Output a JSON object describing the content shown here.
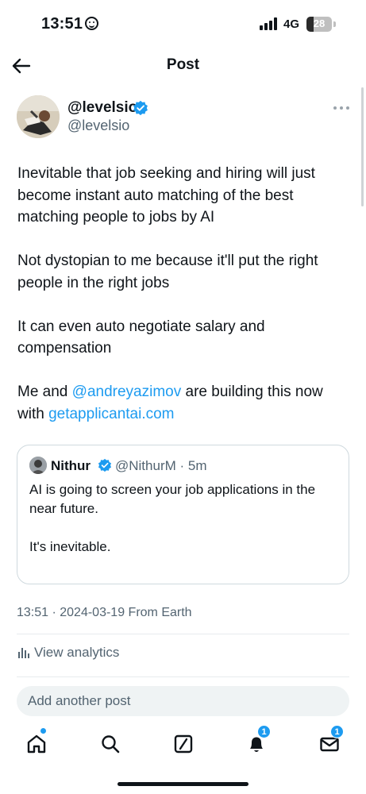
{
  "status_bar": {
    "time": "13:51",
    "network": "4G",
    "battery": "28",
    "battery_level": 0.28
  },
  "header": {
    "title": "Post",
    "back_icon": "arrow-left-icon"
  },
  "post": {
    "author": {
      "display_name": "@levelsio",
      "handle": "@levelsio",
      "verified": true
    },
    "paragraph_1": "Inevitable that job seeking and hiring will just become instant auto matching of the best matching people to jobs by AI",
    "paragraph_2": "Not dystopian to me because it'll put the right people in the right jobs",
    "paragraph_3": "It can even auto negotiate salary and compensation",
    "paragraph_4": {
      "text_before": "Me and ",
      "mention": "@andreyazimov",
      "text_middle": " are building this now with ",
      "link": "getapplicantai.com"
    },
    "timestamp": "13:51 · 2024-03-19 From Earth"
  },
  "quote": {
    "name": "Nithur",
    "handle_time": "@NithurM · 5m",
    "paragraph_1": "AI is going to screen your job applications in the near future.",
    "paragraph_2": "It's inevitable."
  },
  "analytics_label": "View analytics",
  "reply_placeholder": "Add another post",
  "tabs": [
    {
      "name": "home",
      "icon": "home-icon",
      "has_dot": true
    },
    {
      "name": "search",
      "icon": "search-icon"
    },
    {
      "name": "grok",
      "icon": "grok-icon"
    },
    {
      "name": "notifications",
      "icon": "bell-icon",
      "badge": "1"
    },
    {
      "name": "messages",
      "icon": "mail-icon",
      "badge": "1"
    }
  ],
  "colors": {
    "accent": "#1d9bf0",
    "text": "#0f1419",
    "muted": "#536471"
  }
}
